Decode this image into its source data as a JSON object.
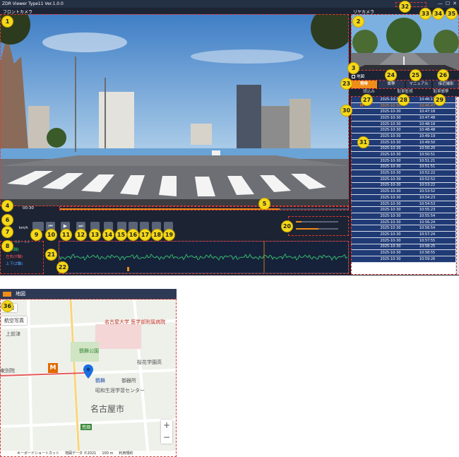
{
  "window": {
    "title": "ZDR Viewer Type11 Ver.1.0.0",
    "min": "—",
    "max": "☐",
    "close": "✕"
  },
  "front_label": "フロントカメラ",
  "rear_label": "リヤカメラ",
  "map_check_label": "地図",
  "tabs": {
    "normal": "常時",
    "impact": "衝撃",
    "manual": "マニュアル",
    "park_approach": "接近撮影"
  },
  "subtabs": {
    "mark": "読込み",
    "drive": "駐車監視",
    "park_impact": "駐車衝撃"
  },
  "time": {
    "current": "00:30",
    "progress": 0.76
  },
  "speed_unit": "km/h",
  "controls": {
    "b10": "⏮",
    "b11": "▶",
    "b12": "⏭"
  },
  "sensor": {
    "header": "0.0 -- 0.0 -- 0.0",
    "x": "前(X軸)",
    "y": "左右(Y軸)",
    "z": "上下(Z軸)"
  },
  "list": [
    {
      "mark": "",
      "date": "2025-10-30",
      "time": "10:46:17"
    },
    {
      "mark": "M",
      "date": "2025-10-30",
      "time": "10:46:47"
    },
    {
      "mark": "",
      "date": "2025-10-30",
      "time": "10:47:18"
    },
    {
      "mark": "",
      "date": "2025-10-30",
      "time": "10:47:48"
    },
    {
      "mark": "",
      "date": "2025-10-30",
      "time": "10:48:18"
    },
    {
      "mark": "",
      "date": "2025-10-30",
      "time": "10:48:48"
    },
    {
      "mark": "",
      "date": "2025-10-30",
      "time": "10:49:19"
    },
    {
      "mark": "",
      "date": "2025-10-30",
      "time": "10:49:50"
    },
    {
      "mark": "",
      "date": "2025-10-30",
      "time": "10:50:20"
    },
    {
      "mark": "",
      "date": "2025-10-30",
      "time": "10:50:51"
    },
    {
      "mark": "",
      "date": "2025-10-30",
      "time": "10:51:21"
    },
    {
      "mark": "",
      "date": "2025-10-30",
      "time": "10:51:51"
    },
    {
      "mark": "",
      "date": "2025-10-30",
      "time": "10:52:22"
    },
    {
      "mark": "",
      "date": "2025-10-30",
      "time": "10:52:52"
    },
    {
      "mark": "",
      "date": "2025-10-30",
      "time": "10:53:22"
    },
    {
      "mark": "",
      "date": "2025-10-30",
      "time": "10:53:52"
    },
    {
      "mark": "",
      "date": "2025-10-30",
      "time": "10:54:23"
    },
    {
      "mark": "",
      "date": "2025-10-30",
      "time": "10:54:53"
    },
    {
      "mark": "",
      "date": "2025-10-30",
      "time": "10:55:23"
    },
    {
      "mark": "",
      "date": "2025-10-30",
      "time": "10:55:54"
    },
    {
      "mark": "",
      "date": "2025-10-30",
      "time": "10:56:24"
    },
    {
      "mark": "",
      "date": "2025-10-30",
      "time": "10:56:54"
    },
    {
      "mark": "",
      "date": "2025-10-30",
      "time": "10:57:24"
    },
    {
      "mark": "",
      "date": "2025-10-30",
      "time": "10:57:55"
    },
    {
      "mark": "",
      "date": "2025-10-30",
      "time": "10:58:25"
    },
    {
      "mark": "",
      "date": "2025-10-30",
      "time": "10:58:55"
    },
    {
      "mark": "",
      "date": "2025-10-30",
      "time": "10:59:26"
    }
  ],
  "map": {
    "title": "地図",
    "type_map": "地図",
    "type_aerial": "航空写真",
    "poi_univ": "名古屋大学 医学部附属病院",
    "poi_park": "鶴舞公園",
    "poi_station": "鶴舞",
    "poi_school": "桜花学園高",
    "poi_gosho": "御器所",
    "poi_showa": "昭和生涯学習センター",
    "city": "名古屋市",
    "kamimaezu": "上前津",
    "higashibetsuin": "東別院",
    "arahata": "荒畑",
    "footer_kbd": "キーボードショートカット",
    "footer_data": "地図データ ©2021",
    "footer_scale": "100 m",
    "footer_terms": "利用規約",
    "zoom_in": "+",
    "zoom_out": "−",
    "marker_m": "M"
  },
  "callouts": [
    "1",
    "2",
    "3",
    "4",
    "5",
    "6",
    "7",
    "8",
    "9",
    "10",
    "11",
    "12",
    "13",
    "14",
    "15",
    "16",
    "17",
    "18",
    "19",
    "20",
    "21",
    "22",
    "23",
    "24",
    "25",
    "26",
    "27",
    "28",
    "29",
    "30",
    "31",
    "32",
    "33",
    "34",
    "35",
    "36"
  ],
  "colors": {
    "accent": "#f08c1a",
    "callout": "#f5d91a",
    "list_bg": "#1f3a75",
    "app_bg": "#1c2333"
  }
}
